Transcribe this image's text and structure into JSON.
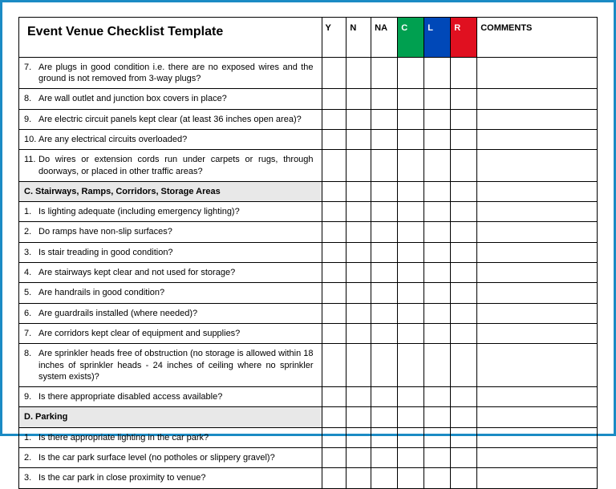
{
  "title": "Event Venue Checklist Template",
  "headers": {
    "y": "Y",
    "n": "N",
    "na": "NA",
    "c": "C",
    "l": "L",
    "r": "R",
    "comments": "COMMENTS"
  },
  "rows": [
    {
      "num": "7.",
      "text": "Are plugs in good condition i.e. there are no exposed wires and the ground is not removed from 3-way plugs?"
    },
    {
      "num": "8.",
      "text": "Are wall outlet and junction box covers in place?"
    },
    {
      "num": "9.",
      "text": "Are electric circuit panels kept clear (at least 36 inches open area)?"
    },
    {
      "num": "10.",
      "text": "Are any electrical circuits overloaded?"
    },
    {
      "num": "11.",
      "text": "Do wires or extension cords run under carpets or rugs, through doorways, or placed in other traffic areas?"
    }
  ],
  "sectionC": "C.  Stairways, Ramps, Corridors, Storage Areas",
  "rowsC": [
    {
      "num": "1.",
      "text": "Is lighting adequate (including emergency lighting)?"
    },
    {
      "num": "2.",
      "text": "Do ramps have non-slip surfaces?"
    },
    {
      "num": "3.",
      "text": "Is stair treading in good condition?"
    },
    {
      "num": "4.",
      "text": "Are stairways kept clear and not used for storage?"
    },
    {
      "num": "5.",
      "text": "Are handrails in good condition?"
    },
    {
      "num": "6.",
      "text": "Are guardrails installed (where needed)?"
    },
    {
      "num": "7.",
      "text": "Are corridors kept clear of equipment and supplies?"
    },
    {
      "num": "8.",
      "text": "Are sprinkler heads free of obstruction (no storage is allowed within 18 inches of sprinkler heads - 24 inches of ceiling where no sprinkler system exists)?"
    },
    {
      "num": "9.",
      "text": "Is there appropriate disabled access available?"
    }
  ],
  "sectionD": "D. Parking",
  "rowsD": [
    {
      "num": "1.",
      "text": "Is there appropriate lighting in the car park?"
    },
    {
      "num": "2.",
      "text": "Is the car park surface level (no potholes or slippery gravel)?"
    },
    {
      "num": "3.",
      "text": "Is the car park in close proximity to venue?"
    }
  ]
}
